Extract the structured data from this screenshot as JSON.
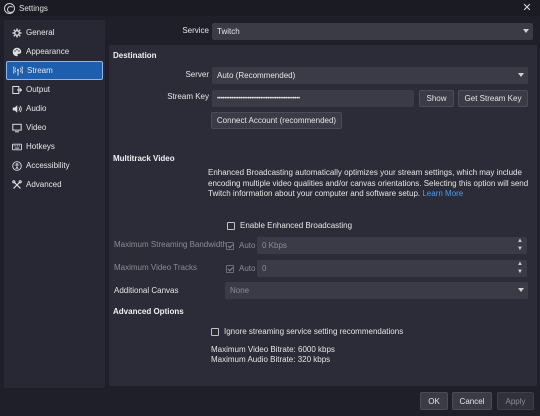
{
  "window": {
    "title": "Settings",
    "close_icon": "close-icon"
  },
  "sidebar": {
    "items": [
      {
        "label": "General",
        "icon": "gear-icon"
      },
      {
        "label": "Appearance",
        "icon": "palette-icon"
      },
      {
        "label": "Stream",
        "icon": "antenna-icon",
        "active": true
      },
      {
        "label": "Output",
        "icon": "output-icon"
      },
      {
        "label": "Audio",
        "icon": "speaker-icon"
      },
      {
        "label": "Video",
        "icon": "monitor-icon"
      },
      {
        "label": "Hotkeys",
        "icon": "keyboard-icon"
      },
      {
        "label": "Accessibility",
        "icon": "accessibility-icon"
      },
      {
        "label": "Advanced",
        "icon": "wrench-icon"
      }
    ]
  },
  "service": {
    "label": "Service",
    "value": "Twitch"
  },
  "destination": {
    "title": "Destination",
    "server_label": "Server",
    "server_value": "Auto (Recommended)",
    "stream_key_label": "Stream Key",
    "stream_key_value": "••••••••••••••••••••••••••••••••••••••••••••••",
    "show_button": "Show",
    "get_key_button": "Get Stream Key",
    "connect_button": "Connect Account (recommended)"
  },
  "multitrack": {
    "title": "Multitrack Video",
    "description": "Enhanced Broadcasting automatically optimizes your stream settings, which may include encoding multiple video qualities and/or canvas orientations. Selecting this option will send Twitch information about your computer and software setup.",
    "learn_more": "Learn More",
    "enable_label": "Enable Enhanced Broadcasting",
    "max_bandwidth_label": "Maximum Streaming Bandwidth",
    "bandwidth_auto_label": "Auto",
    "bandwidth_value": "0 Kbps",
    "max_tracks_label": "Maximum Video Tracks",
    "tracks_auto_label": "Auto",
    "tracks_value": "0",
    "additional_canvas_label": "Additional Canvas",
    "additional_canvas_value": "None"
  },
  "advanced": {
    "title": "Advanced Options",
    "ignore_label": "Ignore streaming service setting recommendations",
    "max_video_bitrate": "Maximum Video Bitrate: 6000 kbps",
    "max_audio_bitrate": "Maximum Audio Bitrate: 320 kbps"
  },
  "footer": {
    "ok": "OK",
    "cancel": "Cancel",
    "apply": "Apply"
  },
  "colors": {
    "accent": "#1d5eae",
    "background": "#1e1f29",
    "panel": "#2b2c37",
    "link": "#4f9bf0"
  }
}
